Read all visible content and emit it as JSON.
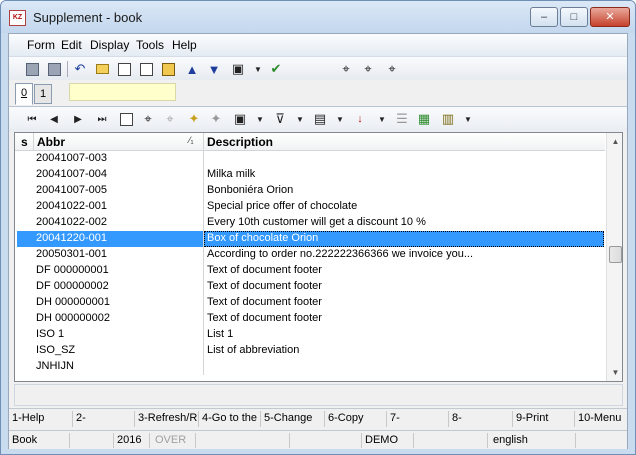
{
  "window": {
    "title": "Supplement - book",
    "app_icon": "KZ",
    "controls": {
      "minimize": "–",
      "maximize": "□",
      "close": "✕"
    }
  },
  "menu": [
    "Form",
    "Edit",
    "Display",
    "Tools",
    "Help"
  ],
  "tabs": {
    "items": [
      "0",
      "1"
    ],
    "active": "0"
  },
  "grid": {
    "columns": {
      "state": "s",
      "abbr": "Abbr",
      "abbr_sort": "⁄₁",
      "description": "Description"
    },
    "rows": [
      {
        "abbr": "20041007-003",
        "desc": ""
      },
      {
        "abbr": "20041007-004",
        "desc": "Milka milk"
      },
      {
        "abbr": "20041007-005",
        "desc": "Bonboniéra Orion"
      },
      {
        "abbr": "20041022-001",
        "desc": "Special price offer of chocolate"
      },
      {
        "abbr": "20041022-002",
        "desc": "Every 10th customer will get a discount 10 %"
      },
      {
        "abbr": "20041220-001",
        "desc": "Box of chocolate Orion",
        "selected": true
      },
      {
        "abbr": "20050301-001",
        "desc": "According to order no.222222366366 we invoice you..."
      },
      {
        "abbr": "DF 000000001",
        "desc": "Text of document footer"
      },
      {
        "abbr": "DF 000000002",
        "desc": "Text of document footer"
      },
      {
        "abbr": "DH 000000001",
        "desc": "Text of document footer"
      },
      {
        "abbr": "DH 000000002",
        "desc": "Text of document footer"
      },
      {
        "abbr": "ISO 1",
        "desc": "List 1"
      },
      {
        "abbr": "ISO_SZ",
        "desc": "List of abbreviation"
      },
      {
        "abbr": "JNHIJN",
        "desc": ""
      }
    ]
  },
  "fkeys": [
    "1-Help",
    "2-",
    "3-Refresh/R",
    "4-Go to the",
    "5-Change",
    "6-Copy",
    "7-",
    "8-",
    "9-Print",
    "10-Menu"
  ],
  "status": {
    "module": "Book",
    "year": "2016",
    "mode": "OVER",
    "db": "DEMO",
    "language": "english"
  }
}
